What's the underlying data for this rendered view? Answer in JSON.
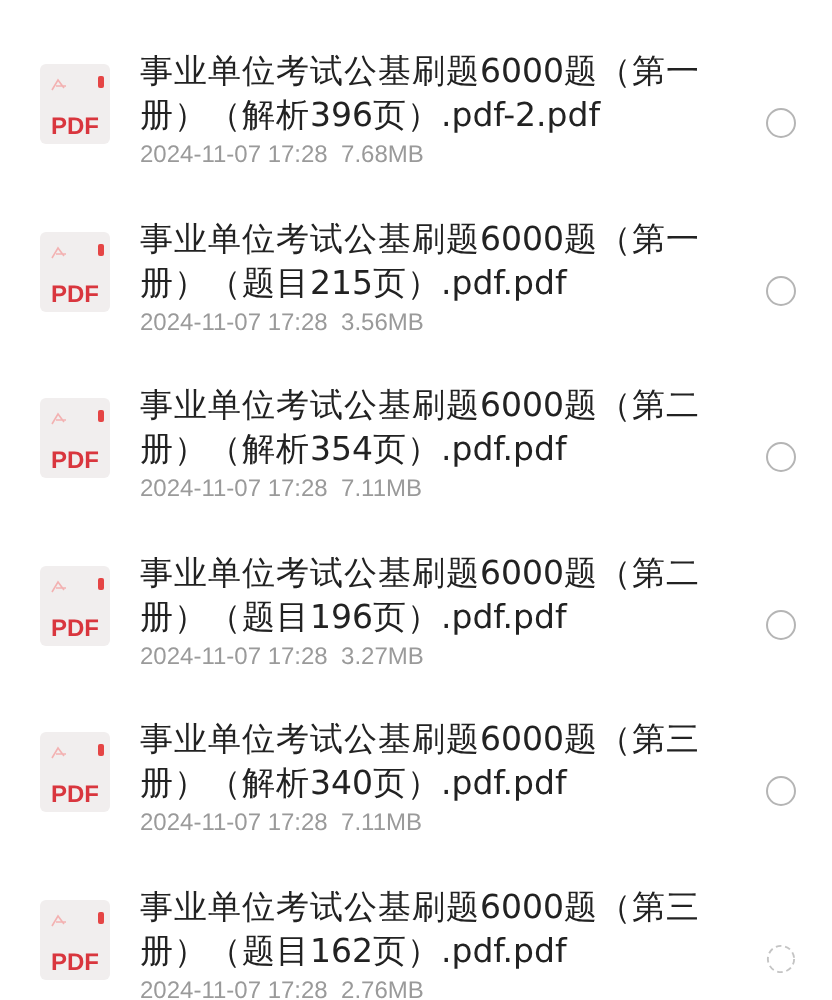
{
  "files": [
    {
      "icon_label": "PDF",
      "title": "事业单位考试公基刷题6000题（第一册）（解析396页）.pdf-2.pdf",
      "date": "2024-11-07 17:28",
      "size": "7.68MB",
      "kind": "radio",
      "selected": false
    },
    {
      "icon_label": "PDF",
      "title": "事业单位考试公基刷题6000题（第一册）（题目215页）.pdf.pdf",
      "date": "2024-11-07 17:28",
      "size": "3.56MB",
      "kind": "radio",
      "selected": false
    },
    {
      "icon_label": "PDF",
      "title": "事业单位考试公基刷题6000题（第二册）（解析354页）.pdf.pdf",
      "date": "2024-11-07 17:28",
      "size": "7.11MB",
      "kind": "radio",
      "selected": false
    },
    {
      "icon_label": "PDF",
      "title": "事业单位考试公基刷题6000题（第二册）（题目196页）.pdf.pdf",
      "date": "2024-11-07 17:28",
      "size": "3.27MB",
      "kind": "radio",
      "selected": false
    },
    {
      "icon_label": "PDF",
      "title": "事业单位考试公基刷题6000题（第三册）（解析340页）.pdf.pdf",
      "date": "2024-11-07 17:28",
      "size": "7.11MB",
      "kind": "radio",
      "selected": false
    },
    {
      "icon_label": "PDF",
      "title": "事业单位考试公基刷题6000题（第三册）（题目162页）.pdf.pdf",
      "date": "2024-11-07 17:28",
      "size": "2.76MB",
      "kind": "loading"
    }
  ]
}
